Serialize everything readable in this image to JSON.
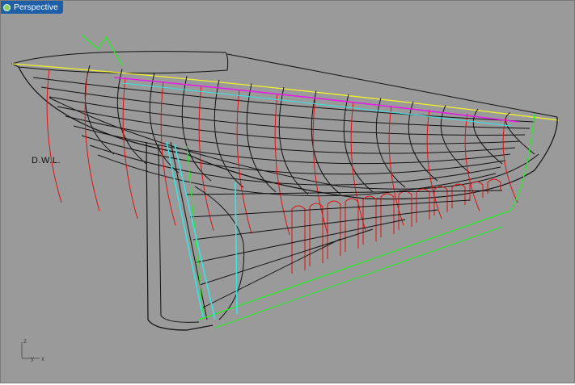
{
  "viewport": {
    "tab_label": "Perspective",
    "annotation": "D.W.L.",
    "axis": {
      "z": "z",
      "y": "y",
      "x": "x"
    },
    "background_color": "#9a9a9a",
    "tab_color": "#1f5fa8"
  },
  "colors": {
    "wire": "#111111",
    "stations": "#e01010",
    "green": "#22ee22",
    "cyan": "#33e6e6",
    "sheer": "#f2f22a",
    "magenta": "#e51ee5"
  }
}
